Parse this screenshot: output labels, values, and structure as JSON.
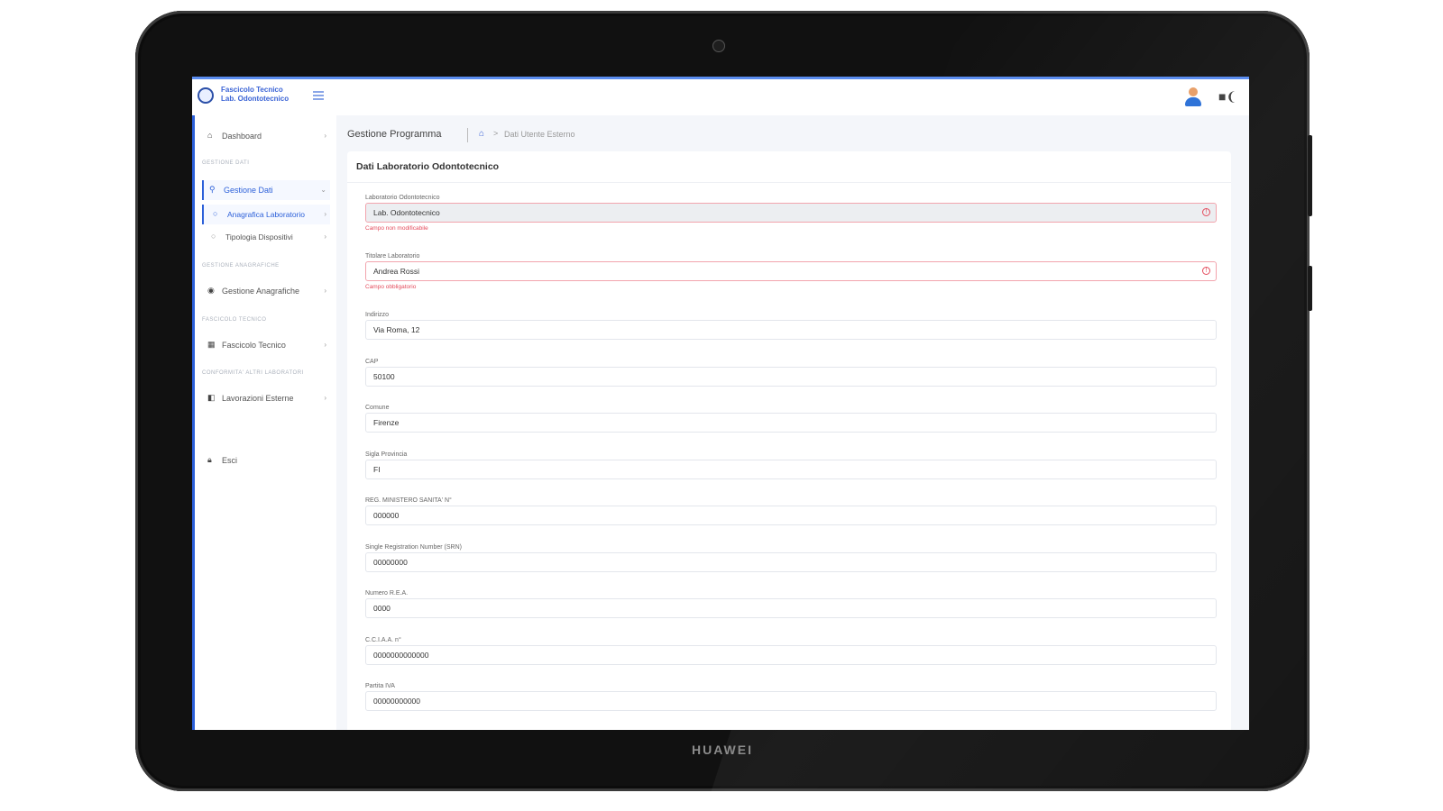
{
  "device": {
    "brand": "HUAWEI"
  },
  "app": {
    "logo_line1": "Fascicolo Tecnico",
    "logo_line2": "Lab. Odontotecnico"
  },
  "sidebar": {
    "items": [
      {
        "label": "Dashboard"
      },
      {
        "section": "GESTIONE DATI"
      },
      {
        "label": "Gestione Dati"
      },
      {
        "label": "Anagrafica Laboratorio"
      },
      {
        "label": "Tipologia Dispositivi"
      },
      {
        "section": "GESTIONE ANAGRAFICHE"
      },
      {
        "label": "Gestione Anagrafiche"
      },
      {
        "section": "FASCICOLO TECNICO"
      },
      {
        "label": "Fascicolo Tecnico"
      },
      {
        "section": "CONFORMITA' ALTRI LABORATORI"
      },
      {
        "label": "Lavorazioni Esterne"
      },
      {
        "label": "Esci"
      }
    ]
  },
  "breadcrumb": {
    "title": "Gestione Programma",
    "page": "Dati Utente Esterno"
  },
  "card": {
    "title": "Dati Laboratorio Odontotecnico"
  },
  "form": {
    "fields": [
      {
        "label": "Laboratorio Odontotecnico",
        "value": "Lab. Odontotecnico",
        "error": "Campo non modificabile"
      },
      {
        "label": "Titolare Laboratorio",
        "value": "Andrea Rossi",
        "error": "Campo obbligatorio"
      },
      {
        "label": "Indirizzo",
        "value": "Via Roma, 12"
      },
      {
        "label": "CAP",
        "value": "50100"
      },
      {
        "label": "Comune",
        "value": "Firenze"
      },
      {
        "label": "Sigla Provincia",
        "value": "FI"
      },
      {
        "label": "REG. MINISTERO SANITA' N°",
        "value": "000000"
      },
      {
        "label": "Single Registration Number (SRN)",
        "value": "00000000"
      },
      {
        "label": "Numero R.E.A.",
        "value": "0000"
      },
      {
        "label": "C.C.I.A.A. n°",
        "value": "0000000000000"
      },
      {
        "label": "Partita IVA",
        "value": "00000000000"
      }
    ]
  },
  "colors": {
    "accent": "#2b5fd9",
    "error": "#e44b5c"
  }
}
